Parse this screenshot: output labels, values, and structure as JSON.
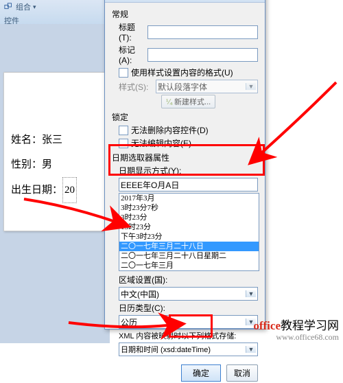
{
  "ribbon": {
    "group_label": "组合",
    "section": "控件"
  },
  "document": {
    "name_label": "姓名：",
    "name_value": "张三",
    "gender_label": "性别：",
    "gender_value": "男",
    "birth_label": "出生日期：",
    "birth_value": "20"
  },
  "dialog": {
    "general": "常规",
    "title_label": "标题(T):",
    "tag_label": "标记(A):",
    "use_style_label": "使用样式设置内容的格式(U)",
    "style_label": "样式(S):",
    "style_value": "默认段落字体",
    "new_style_btn": "新建样式...",
    "lock": "锁定",
    "lock_remove": "无法删除内容控件(D)",
    "lock_edit": "无法编辑内容(E)",
    "dp_section": "日期选取器属性",
    "format_label": "日期显示方式(Y):",
    "format_value": "EEEE年O月A日",
    "list_items": [
      "2017年3月",
      "3时23分7秒",
      "3时23分",
      "15时23分",
      "下午3时23分",
      "二〇一七年三月二十八日",
      "二〇一七年三月二十八日星期二",
      "二〇一七年三月"
    ],
    "list_selected_index": 5,
    "locale_label": "区域设置(国):",
    "locale_value": "中文(中国)",
    "calendar_label": "日历类型(C):",
    "calendar_value": "公历",
    "xml_label": "XML 内容被映射时以下列格式存储:",
    "xml_value": "日期和时间 (xsd:dateTime)",
    "ok": "确定",
    "cancel": "取消"
  },
  "watermark": {
    "brand_red": "office",
    "brand_black": "教程学习网",
    "url": "www.office68.com"
  }
}
